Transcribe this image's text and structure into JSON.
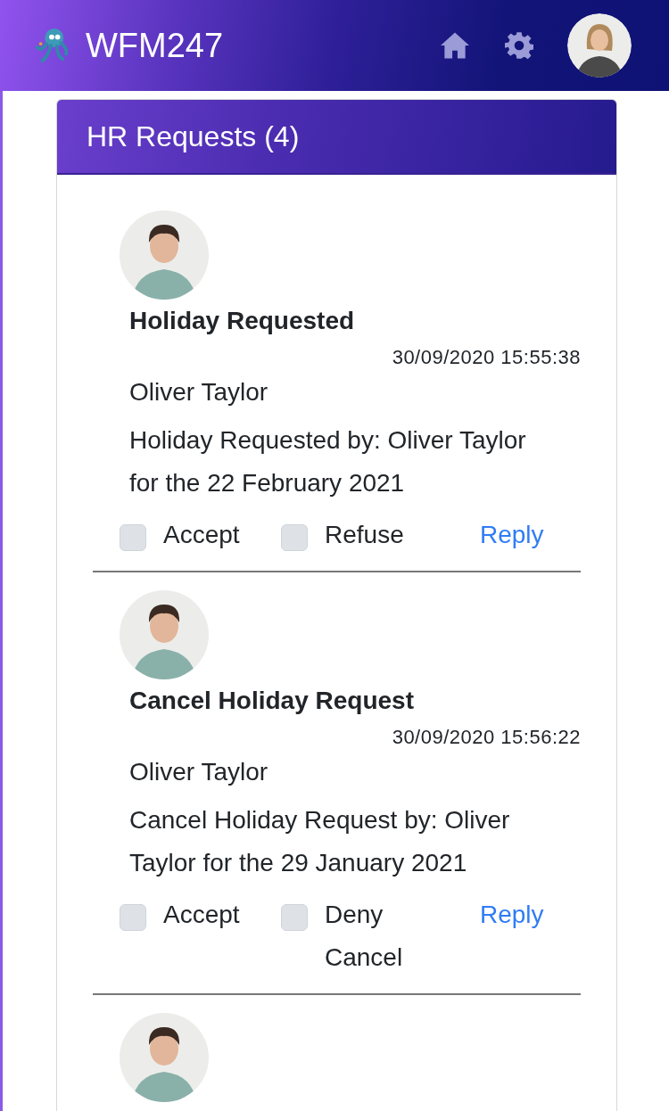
{
  "header": {
    "brand": "WFM247"
  },
  "card": {
    "title": "HR Requests (4)"
  },
  "requests": [
    {
      "title": "Holiday Requested",
      "timestamp": "30/09/2020 15:55:38",
      "name": "Oliver Taylor",
      "message": "Holiday Requested by: Oliver Taylor for the 22 February 2021",
      "options": [
        {
          "label": "Accept",
          "checked": false
        },
        {
          "label": "Refuse",
          "checked": false
        }
      ],
      "reply": "Reply"
    },
    {
      "title": "Cancel Holiday Request",
      "timestamp": "30/09/2020 15:56:22",
      "name": "Oliver Taylor",
      "message": "Cancel Holiday Request by: Oliver Taylor for the 29 January 2021",
      "options": [
        {
          "label": "Accept",
          "checked": false
        },
        {
          "label": "Deny Cancel",
          "checked": false
        }
      ],
      "reply": "Reply"
    },
    {
      "kind": "picture"
    }
  ]
}
